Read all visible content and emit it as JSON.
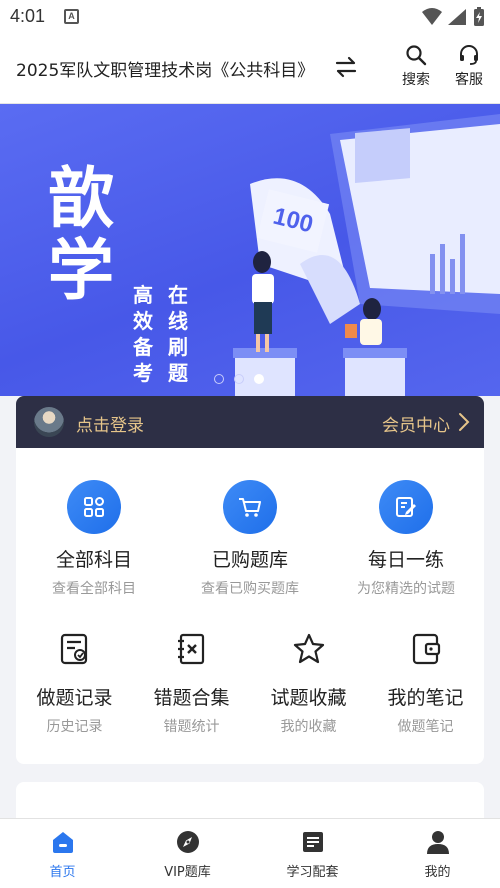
{
  "status": {
    "time": "4:01"
  },
  "header": {
    "title": "2025军队文职管理技术岗《公共科目》",
    "search_label": "搜索",
    "service_label": "客服"
  },
  "banner": {
    "big_1": "歆",
    "big_2": "学",
    "sub_1": "高效备考",
    "sub_2": "在线刷题",
    "paper_number": "100",
    "active_slide": 3,
    "slide_count": 3
  },
  "login": {
    "login_label": "点击登录",
    "member_label": "会员中心"
  },
  "features_top": [
    {
      "title": "全部科目",
      "subtitle": "查看全部科目",
      "icon": "grid-icon"
    },
    {
      "title": "已购题库",
      "subtitle": "查看已购买题库",
      "icon": "cart-icon"
    },
    {
      "title": "每日一练",
      "subtitle": "为您精选的试题",
      "icon": "edit-icon"
    }
  ],
  "features_bottom": [
    {
      "title": "做题记录",
      "subtitle": "历史记录",
      "icon": "record-icon"
    },
    {
      "title": "错题合集",
      "subtitle": "错题统计",
      "icon": "wrong-icon"
    },
    {
      "title": "试题收藏",
      "subtitle": "我的收藏",
      "icon": "star-icon"
    },
    {
      "title": "我的笔记",
      "subtitle": "做题笔记",
      "icon": "note-icon"
    }
  ],
  "tabbar": [
    {
      "label": "首页",
      "icon": "home-icon",
      "active": true
    },
    {
      "label": "VIP题库",
      "icon": "compass-icon",
      "active": false
    },
    {
      "label": "学习配套",
      "icon": "document-icon",
      "active": false
    },
    {
      "label": "我的",
      "icon": "person-icon",
      "active": false
    }
  ],
  "colors": {
    "accent": "#2b77ee",
    "banner": "#4f61ec",
    "login_bar": "#2d2f45",
    "gold": "#e6c58a"
  }
}
